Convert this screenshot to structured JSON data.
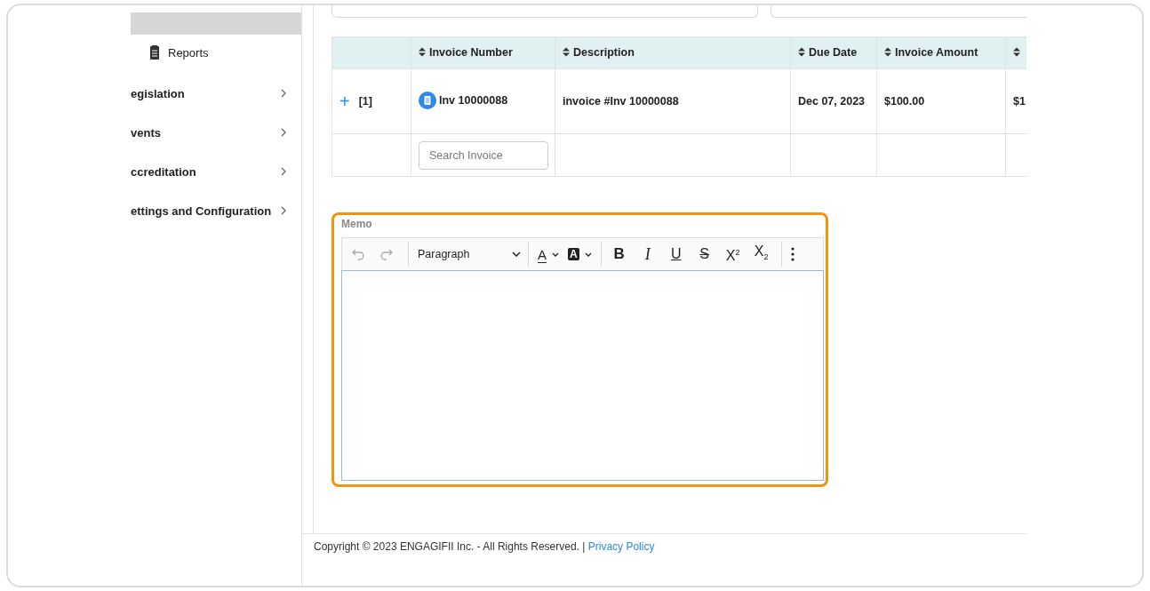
{
  "sidebar": {
    "items": [
      {
        "label": "Reports",
        "kind": "icon"
      },
      {
        "label": "egislation",
        "kind": "group"
      },
      {
        "label": "vents",
        "kind": "group"
      },
      {
        "label": "ccreditation",
        "kind": "group"
      },
      {
        "label": "ettings and Configuration",
        "kind": "group"
      }
    ]
  },
  "table": {
    "columns": [
      {
        "kind": "plain"
      },
      {
        "label": "Invoice Number",
        "kind": "sortable"
      },
      {
        "label": "Description",
        "kind": "sortable"
      },
      {
        "label": "Due Date",
        "kind": "sortable"
      },
      {
        "label": "Invoice Amount",
        "kind": "sortable"
      },
      {
        "kind": "sortable"
      }
    ],
    "rows": [
      {
        "expand": "+",
        "index": "[1]",
        "invoice_number": "Inv 10000088",
        "description": "invoice #Inv 10000088",
        "due_date": "Dec 07, 2023",
        "amount": "$100.00",
        "column_6": "$1"
      }
    ],
    "search": {
      "placeholder": "Search Invoice"
    }
  },
  "memo": {
    "label": "Memo",
    "focused": true,
    "toolbar": [
      {
        "kind": "undo",
        "disabled": true
      },
      {
        "kind": "redo",
        "disabled": true
      },
      {
        "kind": "divider"
      },
      {
        "kind": "select",
        "label": "Paragraph"
      },
      {
        "kind": "divider"
      },
      {
        "kind": "color",
        "label": "A"
      },
      {
        "kind": "highlight",
        "label": "A"
      },
      {
        "kind": "divider"
      },
      {
        "kind": "bold",
        "label": "B"
      },
      {
        "kind": "italic",
        "label": "I"
      },
      {
        "kind": "underline",
        "label": "U"
      },
      {
        "kind": "strike",
        "label": "S"
      },
      {
        "kind": "super",
        "label": "X$^{2}$"
      },
      {
        "kind": "sub",
        "label": "X$_{2}$"
      },
      {
        "kind": "divider"
      },
      {
        "kind": "more"
      }
    ]
  },
  "footer": {
    "text": "Copyright © 2023 ENGAGIFII Inc. - All Rights Reserved. |",
    "link": "Privacy Policy"
  }
}
